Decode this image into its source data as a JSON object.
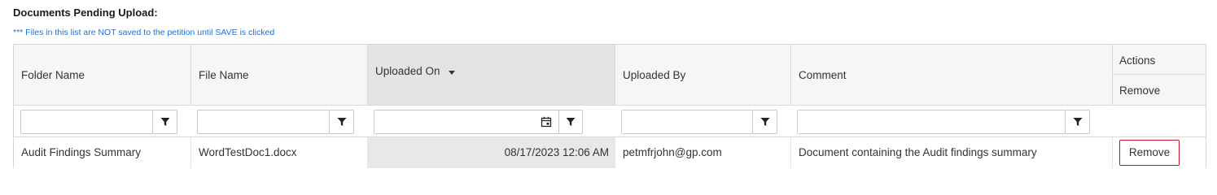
{
  "section": {
    "title": "Documents Pending Upload:",
    "note": "*** Files in this list are NOT saved to the petition until SAVE is clicked"
  },
  "grid": {
    "columns": [
      {
        "key": "folder",
        "label": "Folder Name"
      },
      {
        "key": "file",
        "label": "File Name"
      },
      {
        "key": "uploaded_on",
        "label": "Uploaded On",
        "sorted": "descending"
      },
      {
        "key": "uploaded_by",
        "label": "Uploaded By"
      },
      {
        "key": "comment",
        "label": "Comment"
      },
      {
        "key": "actions",
        "label": "Actions",
        "sub_label": "Remove"
      }
    ],
    "filters": {
      "folder": "",
      "file": "",
      "uploaded_on": "",
      "uploaded_by": "",
      "comment": ""
    },
    "rows": [
      {
        "folder": "Audit Findings Summary",
        "file": "WordTestDoc1.docx",
        "uploaded_on": "08/17/2023 12:06 AM",
        "uploaded_by": "petmfrjohn@gp.com",
        "comment": "Document containing the Audit findings summary",
        "action_label": "Remove"
      }
    ]
  },
  "icons": {
    "filter": "filter-funnel-icon",
    "calendar": "calendar-icon",
    "sort": "sort-descending-icon"
  },
  "colors": {
    "note_text": "#1f6fd1",
    "header_bg": "#f6f6f6",
    "sorted_column_bg": "#e4e4e4",
    "remove_button_border": "#c8102e"
  }
}
